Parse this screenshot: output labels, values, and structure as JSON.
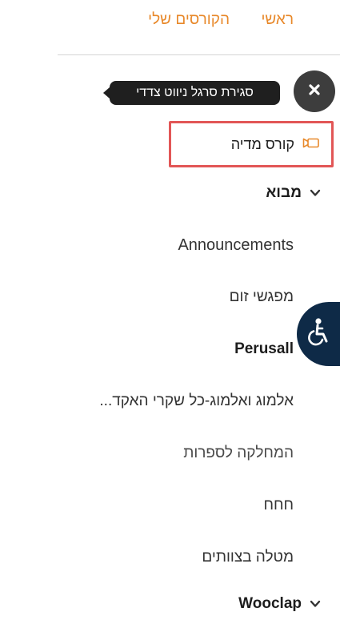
{
  "topnav": {
    "home": "ראשי",
    "my_courses": "הקורסים שלי"
  },
  "sidebar": {
    "close_tooltip": "סגירת סרגל ניווט צדדי",
    "media_course": "קורס מדיה",
    "sections": [
      {
        "label": "מבוא",
        "items": [
          "Announcements",
          "מפגשי זום",
          "Perusall",
          "אלמוג ואלמוג-כל שקרי האקד...",
          "המחלקה לספרות",
          "חחח",
          "מטלה בצוותים"
        ]
      },
      {
        "label": "Wooclap"
      }
    ]
  },
  "colors": {
    "link": "#e8892b",
    "highlight_border": "#e25656",
    "accessibility_button": "#0e2a47",
    "close_button": "#3d3d3d",
    "media_icon": "#e8892b"
  },
  "icons": {
    "close": "close-icon",
    "media": "video-camera-icon",
    "chevron": "chevron-down-icon",
    "accessibility": "wheelchair-accessibility-icon"
  }
}
